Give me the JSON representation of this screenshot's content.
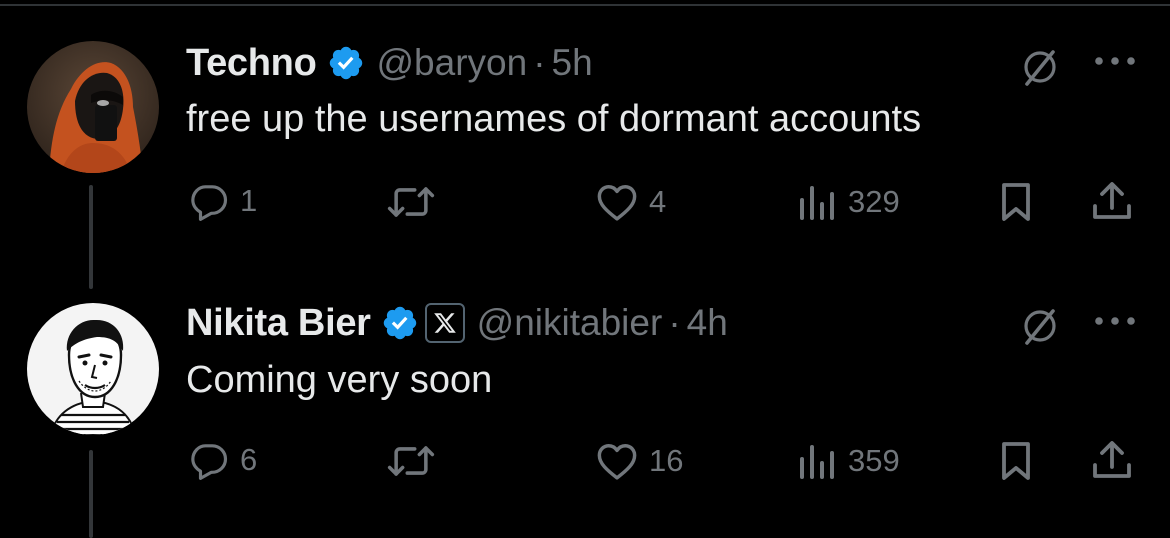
{
  "tweets": [
    {
      "name": "Techno",
      "handle": "@baryon",
      "separator": "·",
      "time": "5h",
      "text": "free up the usernames of dormant accounts",
      "replies": "1",
      "reposts": "",
      "likes": "4",
      "views": "329",
      "verified": true,
      "affiliate_badge": false,
      "avatar": "hooded-figure-avatar"
    },
    {
      "name": "Nikita Bier",
      "handle": "@nikitabier",
      "separator": "·",
      "time": "4h",
      "text": "Coming very soon",
      "replies": "6",
      "reposts": "",
      "likes": "16",
      "views": "359",
      "verified": true,
      "affiliate_badge": true,
      "avatar": "sketch-portrait-avatar"
    }
  ],
  "colors": {
    "background": "#000000",
    "primary_text": "#e7e9ea",
    "secondary_text": "#71767b",
    "verified_blue": "#1d9bf0",
    "divider": "#2f3336"
  }
}
